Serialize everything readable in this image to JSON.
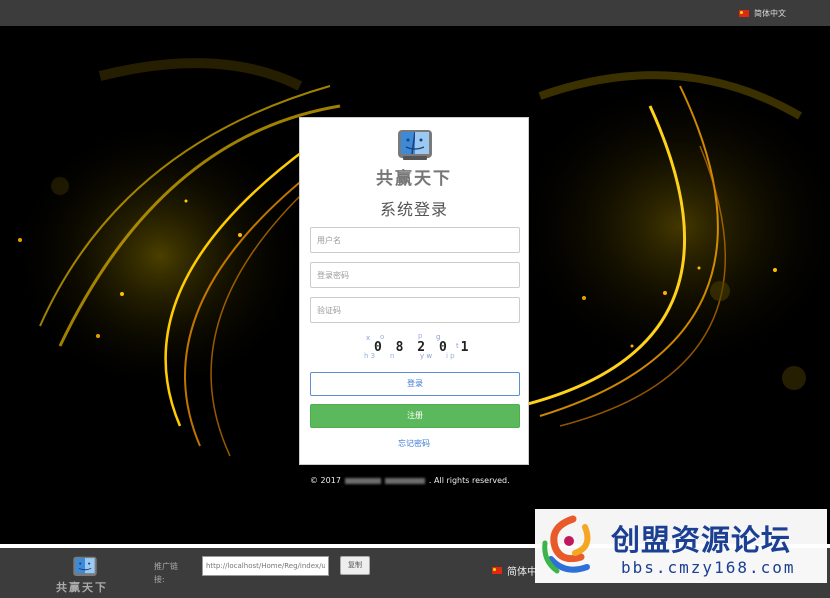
{
  "top_bar": {
    "language": "简体中文"
  },
  "login": {
    "brand": "共赢天下",
    "title": "系统登录",
    "username_placeholder": "用户名",
    "password_placeholder": "登录密码",
    "captcha_placeholder": "验证码",
    "captcha_text": "0 8 2 0 1",
    "login_button": "登录",
    "register_button": "注册",
    "forgot_link": "忘记密码"
  },
  "copyright": {
    "prefix": "© 2017",
    "suffix": ". All rights reserved."
  },
  "footer": {
    "brand": "共赢天下",
    "promo_label": "推广链接:",
    "promo_url": "http://localhost/Home/Reg/index/u",
    "copy_button": "复制",
    "language": "简体中"
  },
  "watermark": {
    "title": "创盟资源论坛",
    "url": "bbs.cmzy168.com"
  },
  "colors": {
    "accent_green": "#5cb85c",
    "link_blue": "#3a7bd5",
    "bar_gray": "#3c3c3c",
    "watermark_blue": "#1a3f93"
  }
}
